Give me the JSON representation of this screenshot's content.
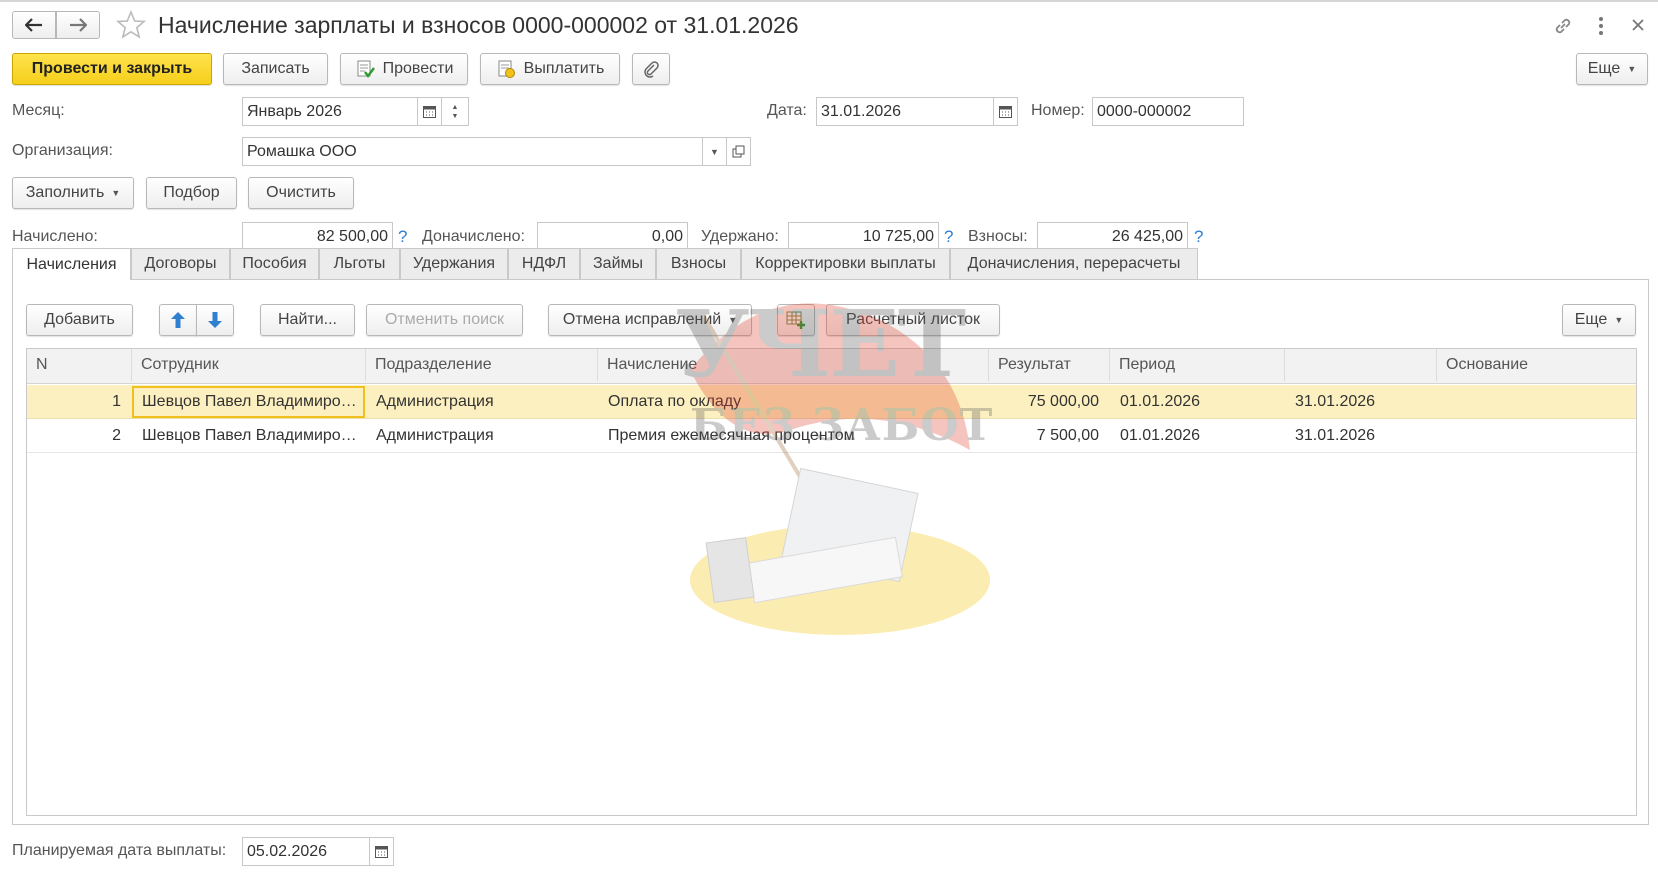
{
  "window": {
    "title": "Начисление зарплаты и взносов 0000-000002 от 31.01.2026",
    "back_icon": "arrow-left-icon",
    "forward_icon": "arrow-right-icon",
    "favorite_icon": "star-icon",
    "link_icon": "link-icon",
    "menu_icon": "kebab-icon",
    "close_icon": "close-icon"
  },
  "toolbar": {
    "post_close": "Провести и закрыть",
    "save": "Записать",
    "post": "Провести",
    "pay": "Выплатить",
    "more": "Еще"
  },
  "header": {
    "month_label": "Месяц:",
    "month_value": "Январь 2026",
    "date_label": "Дата:",
    "date_value": "31.01.2026",
    "number_label": "Номер:",
    "number_value": "0000-000002",
    "org_label": "Организация:",
    "org_value": "Ромашка ООО"
  },
  "actions": {
    "fill": "Заполнить",
    "select": "Подбор",
    "clear": "Очистить"
  },
  "totals": {
    "accrued_label": "Начислено:",
    "accrued_value": "82 500,00",
    "additional_label": "Доначислено:",
    "additional_value": "0,00",
    "withheld_label": "Удержано:",
    "withheld_value": "10 725,00",
    "contrib_label": "Взносы:",
    "contrib_value": "26 425,00",
    "help": "?"
  },
  "tabs": [
    "Начисления",
    "Договоры",
    "Пособия",
    "Льготы",
    "Удержания",
    "НДФЛ",
    "Займы",
    "Взносы",
    "Корректировки выплаты",
    "Доначисления, перерасчеты"
  ],
  "table_toolbar": {
    "add": "Добавить",
    "find": "Найти...",
    "cancel_search": "Отменить поиск",
    "cancel_fixes": "Отмена исправлений",
    "payslip": "Расчетный листок",
    "more": "Еще"
  },
  "table": {
    "columns": [
      "N",
      "Сотрудник",
      "Подразделение",
      "Начисление",
      "Результат",
      "Период",
      "",
      "Основание"
    ],
    "rows": [
      {
        "n": "1",
        "employee": "Шевцов Павел Владимирович",
        "department": "Администрация",
        "accrual": "Оплата по окладу",
        "result": "75 000,00",
        "period_from": "01.01.2026",
        "period_to": "31.01.2026",
        "basis": ""
      },
      {
        "n": "2",
        "employee": "Шевцов Павел Владимирович",
        "department": "Администрация",
        "accrual": "Премия ежемесячная процентом",
        "result": "7 500,00",
        "period_from": "01.01.2026",
        "period_to": "31.01.2026",
        "basis": ""
      }
    ]
  },
  "footer": {
    "pay_date_label": "Планируемая дата выплаты:",
    "pay_date_value": "05.02.2026"
  },
  "watermark": {
    "line1": "УЧЕТ",
    "line2": "БЕЗ ЗАБОТ"
  },
  "colors": {
    "primary_button": "#f5cf1a",
    "selected_row": "#fdf0c0",
    "help_icon": "#2f7fd1"
  }
}
